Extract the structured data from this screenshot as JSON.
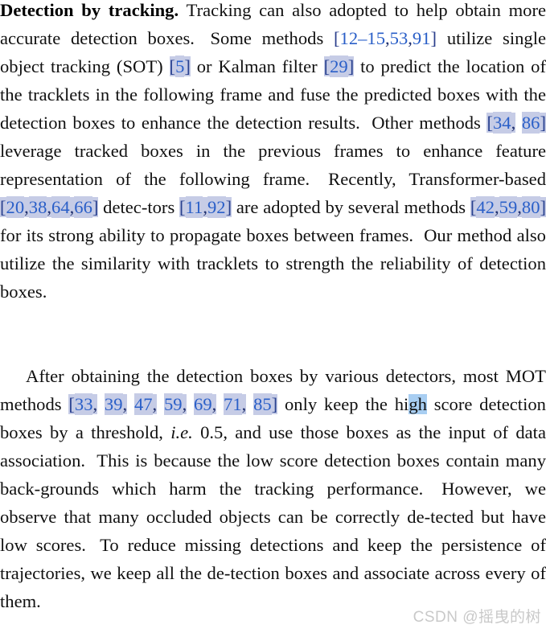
{
  "document": {
    "type": "academic-paper-excerpt",
    "background_color": "#ffffff",
    "text_color": "#101010",
    "citation_color": "#2a5fc8",
    "citation_highlight_color": "#c6cce6",
    "selection_highlight_color": "#a8cef2",
    "watermark_color": "#c9c9c9"
  },
  "paragraph1": {
    "runin": "Detection by tracking.",
    "t1": "Tracking can also adopted to help obtain more accurate detection boxes.",
    "t2": "Some methods",
    "c1": "12–15",
    "c1b": "53",
    "c1c": "91",
    "t3": "utilize single object tracking (SOT)",
    "c2": "5",
    "t4": "or Kalman filter",
    "c3": "29",
    "t5": "to predict the location of the tracklets in the following frame and fuse the predicted boxes with the detection boxes to enhance the detection results.",
    "t6": "Other methods",
    "c4": "34",
    "c5": "86",
    "t7": "leverage tracked boxes in the previous frames to enhance feature representation of the following frame.",
    "t8": "Recently, Transformer-based",
    "c6": "20",
    "c7": "38",
    "c8": "64",
    "c9": "66",
    "t9": "detec-tors",
    "t9a": "detec-",
    "t9b": "tors",
    "c10": "11",
    "c11": "92",
    "t10": "are adopted by several methods",
    "c12": "42",
    "c13": "59",
    "c14": "80",
    "t11": "for its strong ability to propagate boxes between frames.",
    "t12": "Our method also utilize the similarity with tracklets to strength the reliability of detection boxes."
  },
  "paragraph2": {
    "t1": "After obtaining the detection boxes by various detectors, most MOT methods",
    "c1": "33",
    "c2": "39",
    "c3": "47",
    "c4": "59",
    "c5": "69",
    "c6": "71",
    "c7": "85",
    "t2": "only keep the",
    "t3_hi": "hi",
    "t3_gh": "gh",
    "t4": "score detection boxes by a threshold,",
    "t5_ie": "i.e.",
    "t6": "0.5, and use those boxes as the input of data association.",
    "t7": "This is because the low score detection boxes contain many back-grounds which harm the tracking performance.",
    "t7a": "This is because the low score detection boxes contain many back-",
    "t7b": "grounds which harm the tracking performance.",
    "t8": "However, we observe that many occluded objects can be correctly de-tected but have low scores.",
    "t8a": "However, we observe that many occluded objects can be correctly de-",
    "t8b": "tected but have low scores.",
    "t9": "To reduce missing detections and keep the persistence of trajectories, we keep all the de-tection boxes and associate across every of them.",
    "t9a": "To reduce missing detections and keep the persistence of trajectories, we keep all the de-",
    "t9b": "tection boxes and associate across every of them."
  },
  "watermark": {
    "text": "CSDN @摇曳的树"
  },
  "brackets": {
    "open": "[",
    "close": "]",
    "comma": ",",
    "period": "."
  }
}
